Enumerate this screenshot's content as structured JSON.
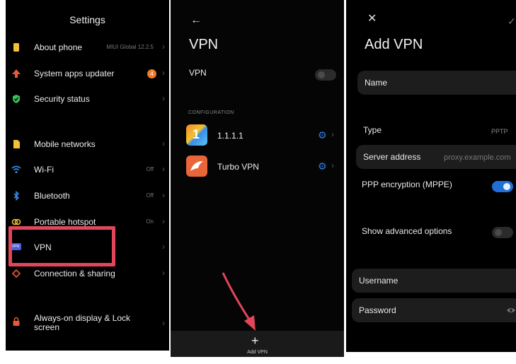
{
  "settings": {
    "title": "Settings",
    "items": [
      {
        "label": "About phone",
        "value": "MIUI Global 12.2.5"
      },
      {
        "label": "System apps updater",
        "badge": "4"
      },
      {
        "label": "Security status"
      },
      {
        "label": "Mobile networks"
      },
      {
        "label": "Wi-Fi",
        "value": "Off"
      },
      {
        "label": "Bluetooth",
        "value": "Off"
      },
      {
        "label": "Portable hotspot",
        "value": "On"
      },
      {
        "label": "VPN",
        "icon_text": "VPN"
      },
      {
        "label": "Connection & sharing"
      },
      {
        "label": "Always-on display & Lock screen"
      }
    ]
  },
  "vpn": {
    "title": "VPN",
    "toggle_label": "VPN",
    "toggle_on": false,
    "section": "CONFIGURATION",
    "configs": [
      {
        "name": "1.1.1.1",
        "icon_text": "1"
      },
      {
        "name": "Turbo VPN"
      }
    ],
    "add_label": "Add VPN"
  },
  "add_vpn": {
    "title": "Add VPN",
    "name_label": "Name",
    "type_label": "Type",
    "type_value": "PPTP",
    "server_label": "Server address",
    "server_placeholder": "proxy.example.com",
    "ppp_label": "PPP encryption (MPPE)",
    "ppp_on": true,
    "advanced_label": "Show advanced options",
    "advanced_on": false,
    "username_label": "Username",
    "password_label": "Password"
  },
  "colors": {
    "accent": "#1f6fd6",
    "highlight": "#e1465a",
    "badge": "#f07a2a",
    "arrow": "#e24659"
  }
}
